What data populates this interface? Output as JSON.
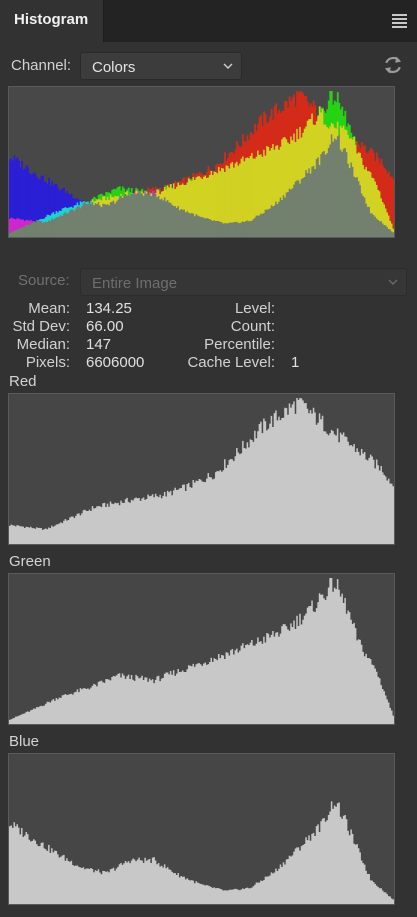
{
  "panel": {
    "title": "Histogram",
    "menu_icon": "panel-menu-icon"
  },
  "channel": {
    "label": "Channel:",
    "value": "Colors",
    "refresh_icon": "refresh-icon"
  },
  "source": {
    "label": "Source:",
    "value": "Entire Image"
  },
  "stats": {
    "mean_label": "Mean:",
    "mean": "134.25",
    "std_label": "Std Dev:",
    "std": "66.00",
    "median_label": "Median:",
    "median": "147",
    "pixels_label": "Pixels:",
    "pixels": "6606000",
    "level_label": "Level:",
    "count_label": "Count:",
    "percentile_label": "Percentile:",
    "cache_label": "Cache Level:",
    "cache": "1"
  },
  "channels": {
    "red": "Red",
    "green": "Green",
    "blue": "Blue"
  },
  "colors": {
    "red": "#d42a1a",
    "green": "#27d214",
    "blue": "#2a1fd6",
    "yellow": "#d2d222",
    "magenta": "#cf26cf",
    "cyan": "#1fd1d1",
    "gray": "#73806f",
    "channel_fill": "#c8c8c8"
  },
  "histogram": {
    "red": [
      [
        0,
        0.13
      ],
      [
        24,
        0.1
      ],
      [
        56,
        0.25
      ],
      [
        80,
        0.3
      ],
      [
        104,
        0.34
      ],
      [
        120,
        0.4
      ],
      [
        136,
        0.48
      ],
      [
        152,
        0.63
      ],
      [
        168,
        0.8
      ],
      [
        184,
        0.91
      ],
      [
        192,
        0.97
      ],
      [
        200,
        0.9
      ],
      [
        216,
        0.76
      ],
      [
        232,
        0.64
      ],
      [
        248,
        0.51
      ],
      [
        255,
        0.4
      ]
    ],
    "green": [
      [
        0,
        0.03
      ],
      [
        16,
        0.1
      ],
      [
        32,
        0.18
      ],
      [
        56,
        0.26
      ],
      [
        72,
        0.33
      ],
      [
        96,
        0.3
      ],
      [
        112,
        0.36
      ],
      [
        136,
        0.45
      ],
      [
        160,
        0.54
      ],
      [
        184,
        0.65
      ],
      [
        200,
        0.78
      ],
      [
        208,
        0.88
      ],
      [
        216,
        0.97
      ],
      [
        224,
        0.8
      ],
      [
        232,
        0.56
      ],
      [
        244,
        0.36
      ],
      [
        255,
        0.06
      ]
    ],
    "blue": [
      [
        0,
        0.55
      ],
      [
        12,
        0.47
      ],
      [
        32,
        0.34
      ],
      [
        48,
        0.25
      ],
      [
        64,
        0.21
      ],
      [
        80,
        0.3
      ],
      [
        96,
        0.3
      ],
      [
        112,
        0.2
      ],
      [
        128,
        0.13
      ],
      [
        144,
        0.09
      ],
      [
        160,
        0.11
      ],
      [
        176,
        0.22
      ],
      [
        192,
        0.38
      ],
      [
        208,
        0.55
      ],
      [
        216,
        0.71
      ],
      [
        224,
        0.55
      ],
      [
        240,
        0.17
      ],
      [
        255,
        0.03
      ]
    ]
  }
}
